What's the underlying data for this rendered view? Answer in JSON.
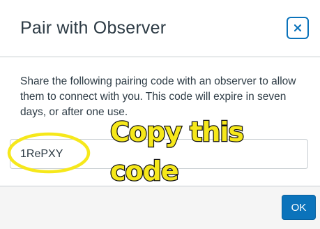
{
  "dialog": {
    "title": "Pair with Observer",
    "close_icon": "close-icon",
    "accent_color": "#0b73bb",
    "description": "Share the following pairing code with an observer to allow them to connect with you. This code will expire in seven days, or after one use.",
    "pairing_code": "1RePXY",
    "ok_label": "OK"
  },
  "annotation": {
    "line1": "Copy this",
    "line2": "code",
    "highlight_color": "#f6e81b"
  }
}
